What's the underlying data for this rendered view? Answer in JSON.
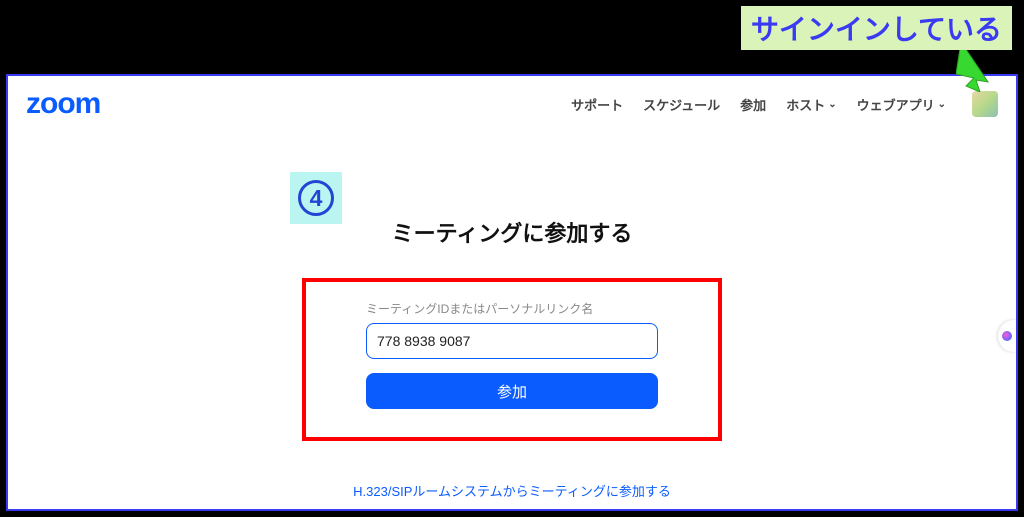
{
  "annotation": {
    "label": "サインインしている"
  },
  "header": {
    "logo": "zoom",
    "nav": {
      "support": "サポート",
      "schedule": "スケジュール",
      "join": "参加",
      "host": "ホスト",
      "webapp": "ウェブアプリ"
    }
  },
  "step_badge": "4",
  "page_title": "ミーティングに参加する",
  "form": {
    "field_label": "ミーティングIDまたはパーソナルリンク名",
    "meeting_id_value": "778 8938 9087",
    "join_button": "参加"
  },
  "alt_link": "H.323/SIPルームシステムからミーティングに参加する"
}
